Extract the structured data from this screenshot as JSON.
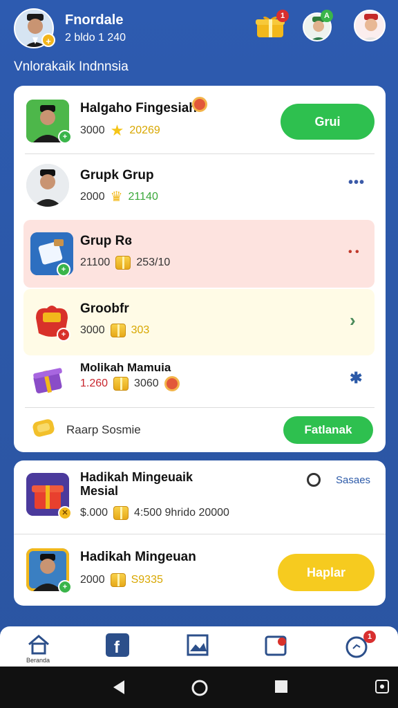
{
  "header": {
    "user_name": "Fnordale",
    "user_sub": "2 bldo 1 240",
    "avatar_badge": "+",
    "gift_notif": "1",
    "friend1_notif": "A",
    "section_title": "Vnlorakaik Indnnsia"
  },
  "card1": {
    "rows": [
      {
        "title": "Halgaho Fingesiah",
        "stat1": "3000",
        "stat2": "20269",
        "button": "Grui",
        "badge": "+"
      },
      {
        "title": "Grupk Grup",
        "stat1": "2000",
        "stat2": "21140",
        "menu": "•••"
      },
      {
        "title": "Grup Rɞ",
        "stat1": "21100",
        "stat2": "253/10",
        "menu": "• •",
        "badge": "+"
      },
      {
        "title": "Groobfr",
        "stat1": "3000",
        "stat2": "303",
        "chevron": "›",
        "badge": "+"
      },
      {
        "title": "Molikah Mamuia",
        "stat1": "1.260",
        "stat2": "3060",
        "side": "✱"
      }
    ],
    "footer": {
      "label": "Raarp Sosmie",
      "button": "Fatlanak"
    }
  },
  "card2": {
    "rows": [
      {
        "title_line1": "Hadikah Mingeuaik",
        "title_line2": "Mesial",
        "stat1": "$.000",
        "stat2": "4:500 9hrido 20000",
        "right_label": "Sasaes"
      },
      {
        "title": "Hadikah Mingeuan",
        "stat1": "2000",
        "stat2": "S9335",
        "button": "Haplar"
      }
    ]
  },
  "bottom_nav": {
    "home_label": "Beranda",
    "notif": "1"
  },
  "colors": {
    "background": "#2d5bb0",
    "green_button": "#2ec04f",
    "yellow_button": "#f6cb1f",
    "pink_row": "#fde3df",
    "yellow_row": "#fffbe6"
  },
  "icons": [
    "home-icon",
    "facebook-icon",
    "gallery-icon",
    "calendar-icon",
    "chat-icon",
    "gift-icon"
  ]
}
